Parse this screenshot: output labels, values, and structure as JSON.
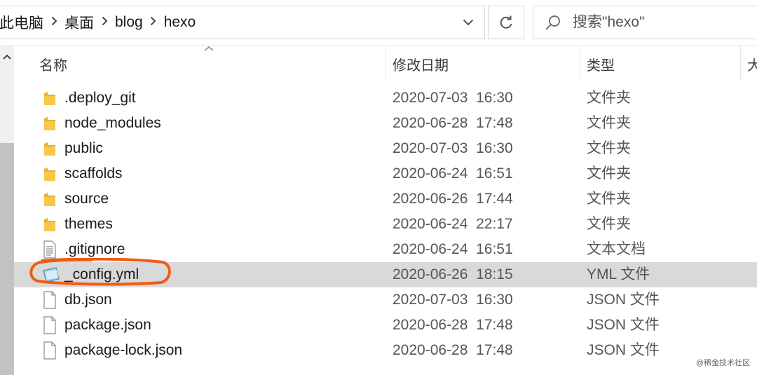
{
  "address_bar": {
    "crumbs": [
      "此电脑",
      "桌面",
      "blog",
      "hexo"
    ]
  },
  "search": {
    "placeholder": "搜索\"hexo\""
  },
  "columns": {
    "name": "名称",
    "date": "修改日期",
    "type": "类型",
    "size": "大"
  },
  "files": [
    {
      "name": ".deploy_git",
      "date": "2020-07-03  16:30",
      "type": "文件夹",
      "icon": "folder-icon"
    },
    {
      "name": "node_modules",
      "date": "2020-06-28  17:48",
      "type": "文件夹",
      "icon": "folder-icon"
    },
    {
      "name": "public",
      "date": "2020-07-03  16:30",
      "type": "文件夹",
      "icon": "folder-icon"
    },
    {
      "name": "scaffolds",
      "date": "2020-06-24  16:51",
      "type": "文件夹",
      "icon": "folder-icon"
    },
    {
      "name": "source",
      "date": "2020-06-26  17:44",
      "type": "文件夹",
      "icon": "folder-icon"
    },
    {
      "name": "themes",
      "date": "2020-06-24  22:17",
      "type": "文件夹",
      "icon": "folder-icon"
    },
    {
      "name": ".gitignore",
      "date": "2020-06-24  16:51",
      "type": "文本文档",
      "icon": "text-file-icon"
    },
    {
      "name": "_config.yml",
      "date": "2020-06-26  18:15",
      "type": "YML 文件",
      "icon": "yml-file-icon",
      "selected": true
    },
    {
      "name": "db.json",
      "date": "2020-07-03  16:30",
      "type": "JSON 文件",
      "icon": "file-icon"
    },
    {
      "name": "package.json",
      "date": "2020-06-28  17:48",
      "type": "JSON 文件",
      "icon": "file-icon"
    },
    {
      "name": "package-lock.json",
      "date": "2020-06-28  17:48",
      "type": "JSON 文件",
      "icon": "file-icon"
    }
  ],
  "colors": {
    "selected_row": "#d9d9d9",
    "annotation": "#f25a12",
    "folder": "#f8c846"
  },
  "watermark": "@稀金技术社区"
}
